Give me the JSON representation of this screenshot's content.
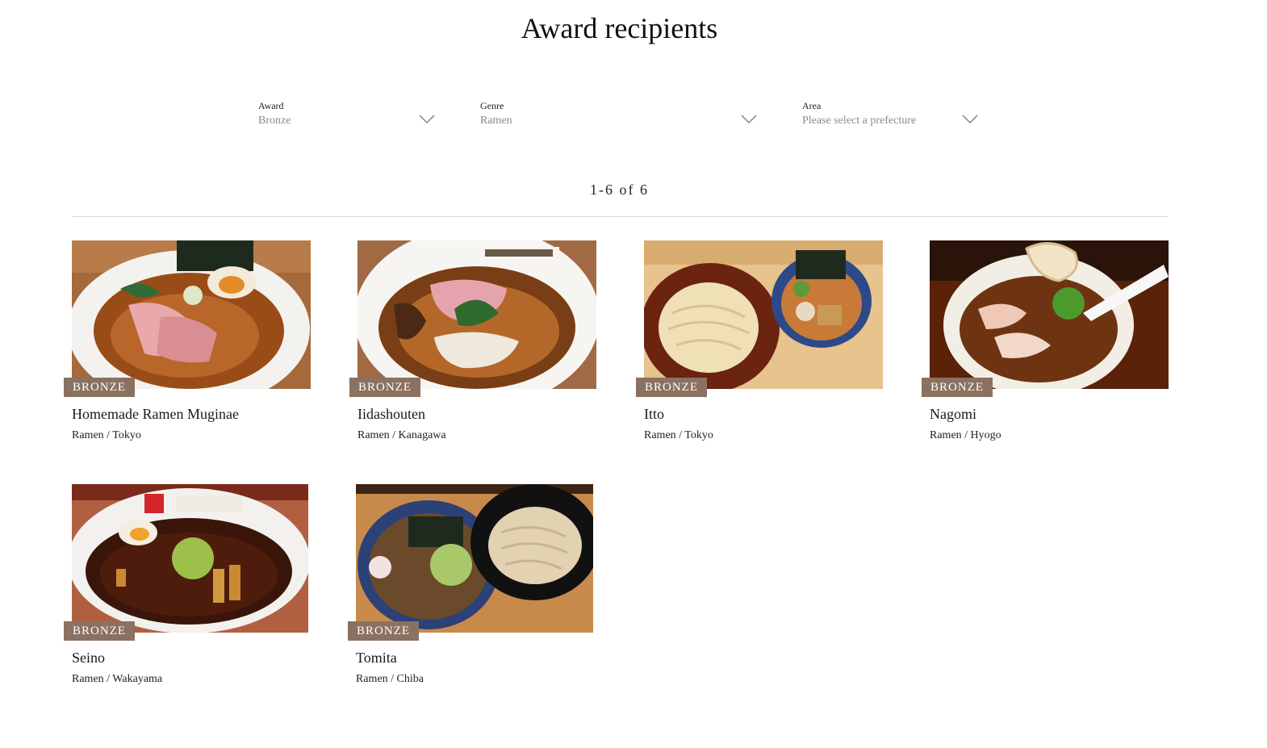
{
  "page_title": "Award recipients",
  "filters": {
    "award": {
      "label": "Award",
      "value": "Bronze"
    },
    "genre": {
      "label": "Genre",
      "value": "Ramen"
    },
    "area": {
      "label": "Area",
      "placeholder": "Please select a prefecture"
    }
  },
  "result_count": "1-6 of 6",
  "badge_color": "#8b7161",
  "cards": [
    {
      "badge": "BRONZE",
      "name": "Homemade Ramen Muginae",
      "meta": "Ramen / Tokyo"
    },
    {
      "badge": "BRONZE",
      "name": "Iidashouten",
      "meta": "Ramen / Kanagawa"
    },
    {
      "badge": "BRONZE",
      "name": "Itto",
      "meta": "Ramen / Tokyo"
    },
    {
      "badge": "BRONZE",
      "name": "Nagomi",
      "meta": "Ramen / Hyogo"
    },
    {
      "badge": "BRONZE",
      "name": "Seino",
      "meta": "Ramen / Wakayama"
    },
    {
      "badge": "BRONZE",
      "name": "Tomita",
      "meta": "Ramen / Chiba"
    }
  ]
}
